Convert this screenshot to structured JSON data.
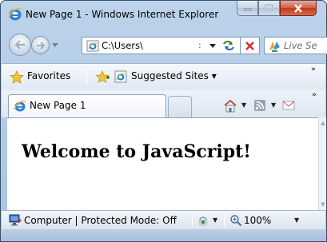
{
  "window": {
    "title": "New Page 1 - Windows Internet Explorer"
  },
  "nav": {
    "address": "C:\\Users\\",
    "address_caret": ":",
    "search_placeholder": "Live Se"
  },
  "favorites_bar": {
    "favorites_label": "Favorites",
    "suggested_sites_label": "Suggested Sites ▾",
    "overflow": "»"
  },
  "tabs": {
    "items": [
      {
        "label": "New Page 1"
      }
    ],
    "overflow": "»"
  },
  "page": {
    "heading": "Welcome to JavaScript!"
  },
  "status": {
    "zone_text": "Computer | Protected Mode: Off",
    "zoom": "100%"
  },
  "icons": {
    "ie": "ie-logo-icon",
    "back": "back-arrow-icon",
    "forward": "forward-arrow-icon",
    "refresh": "refresh-icon",
    "stop": "stop-icon",
    "search": "live-search-icon",
    "favorites": "favorites-star-icon",
    "add_favorite": "add-favorite-icon",
    "home": "home-icon",
    "feeds": "feeds-icon",
    "mail": "mail-icon",
    "zone": "computer-zone-icon",
    "zoom": "zoom-icon"
  },
  "colors": {
    "frame": "#bcd3ea",
    "close_button": "#c13a20",
    "page_background": "#ffffff"
  }
}
